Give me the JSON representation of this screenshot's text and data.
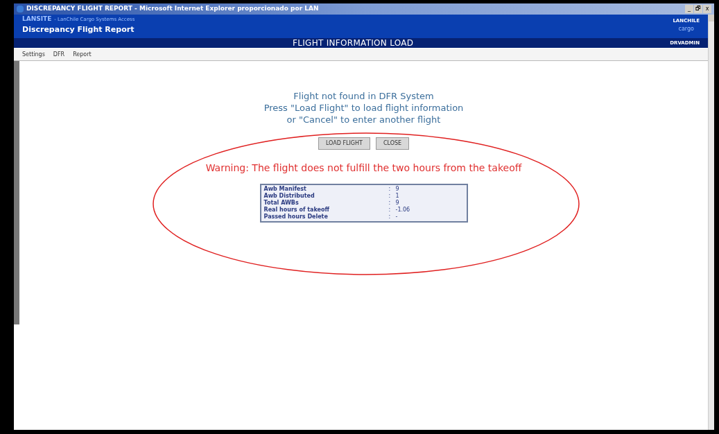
{
  "window": {
    "title": "DISCREPANCY FLIGHT REPORT - Microsoft Internet Explorer proporcionado por LAN",
    "controls": [
      "_",
      "🗗",
      "x"
    ]
  },
  "header": {
    "site": "LANSITE",
    "site_subtitle": "- LanChile Cargo Systems Access",
    "app_title": "Discrepancy Flight Report",
    "page_title": "FLIGHT INFORMATION LOAD",
    "logo_text": "LANCHILE",
    "logo_subtext": "cargo",
    "user": "DRVADMIN"
  },
  "menu": [
    "Settings",
    "DFR",
    "Report"
  ],
  "message": [
    "Flight not found in DFR System",
    "Press \"Load Flight\" to load flight information",
    "or \"Cancel\" to enter another flight"
  ],
  "buttons": [
    "LOAD FLIGHT",
    "CLOSE"
  ],
  "warning": "Warning: The flight does not fulfill the two hours from the takeoff",
  "summary": [
    {
      "label": "Awb Manifest",
      "separator": ":",
      "value": "9"
    },
    {
      "label": "Awb Distributed",
      "separator": ":",
      "value": "1"
    },
    {
      "label": "Total AWBs",
      "separator": ":",
      "value": "9"
    },
    {
      "label": "Real hours of takeoff",
      "separator": ":",
      "value": "-1.06"
    },
    {
      "label": "Passed hours Delete",
      "separator": ":",
      "value": "-"
    }
  ]
}
